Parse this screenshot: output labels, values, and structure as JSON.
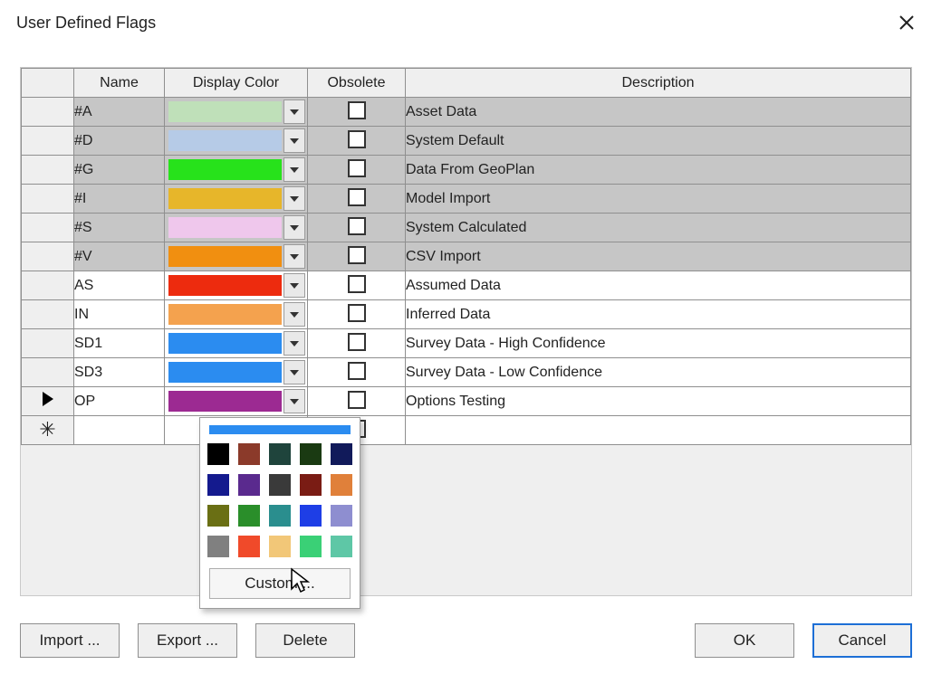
{
  "dialog": {
    "title": "User Defined Flags"
  },
  "columns": {
    "name": "Name",
    "display_color": "Display Color",
    "obsolete": "Obsolete",
    "description": "Description"
  },
  "flags": [
    {
      "name": "#A",
      "color": "#bfe0b9",
      "obsolete": false,
      "description": "Asset Data",
      "system": true
    },
    {
      "name": "#D",
      "color": "#b6cbe7",
      "obsolete": false,
      "description": "System Default",
      "system": true
    },
    {
      "name": "#G",
      "color": "#27e21b",
      "obsolete": false,
      "description": "Data From GeoPlan",
      "system": true
    },
    {
      "name": "#I",
      "color": "#e7b62a",
      "obsolete": false,
      "description": "Model Import",
      "system": true
    },
    {
      "name": "#S",
      "color": "#efc7ec",
      "obsolete": false,
      "description": "System Calculated",
      "system": true
    },
    {
      "name": "#V",
      "color": "#f18f10",
      "obsolete": false,
      "description": "CSV Import",
      "system": true
    },
    {
      "name": "AS",
      "color": "#ed2b0e",
      "obsolete": false,
      "description": "Assumed Data",
      "system": false
    },
    {
      "name": "IN",
      "color": "#f4a24e",
      "obsolete": false,
      "description": "Inferred Data",
      "system": false
    },
    {
      "name": "SD1",
      "color": "#2b8cf0",
      "obsolete": false,
      "description": "Survey Data - High Confidence",
      "system": false
    },
    {
      "name": "SD3",
      "color": "#2b8cf0",
      "obsolete": false,
      "description": "Survey Data - Low Confidence",
      "system": false
    },
    {
      "name": "OP",
      "color": "#9c2a92",
      "obsolete": false,
      "description": "Options Testing",
      "system": false,
      "current": true
    }
  ],
  "picker": {
    "selected": "#2b8cf0",
    "colors": [
      "#000000",
      "#8b3a2a",
      "#1f443c",
      "#1a3a12",
      "#111a5a",
      "#141a8e",
      "#5a2a8e",
      "#3a3a3a",
      "#7a1c14",
      "#e0803a",
      "#6a6f14",
      "#2a8e2a",
      "#2a8e8e",
      "#1e3ee6",
      "#8e8ed0",
      "#808080",
      "#f04a2a",
      "#f2c778",
      "#3ad076",
      "#5ec7a6"
    ],
    "custom_label": "Custom ..."
  },
  "buttons": {
    "import": "Import ...",
    "export": "Export ...",
    "delete": "Delete",
    "ok": "OK",
    "cancel": "Cancel"
  }
}
